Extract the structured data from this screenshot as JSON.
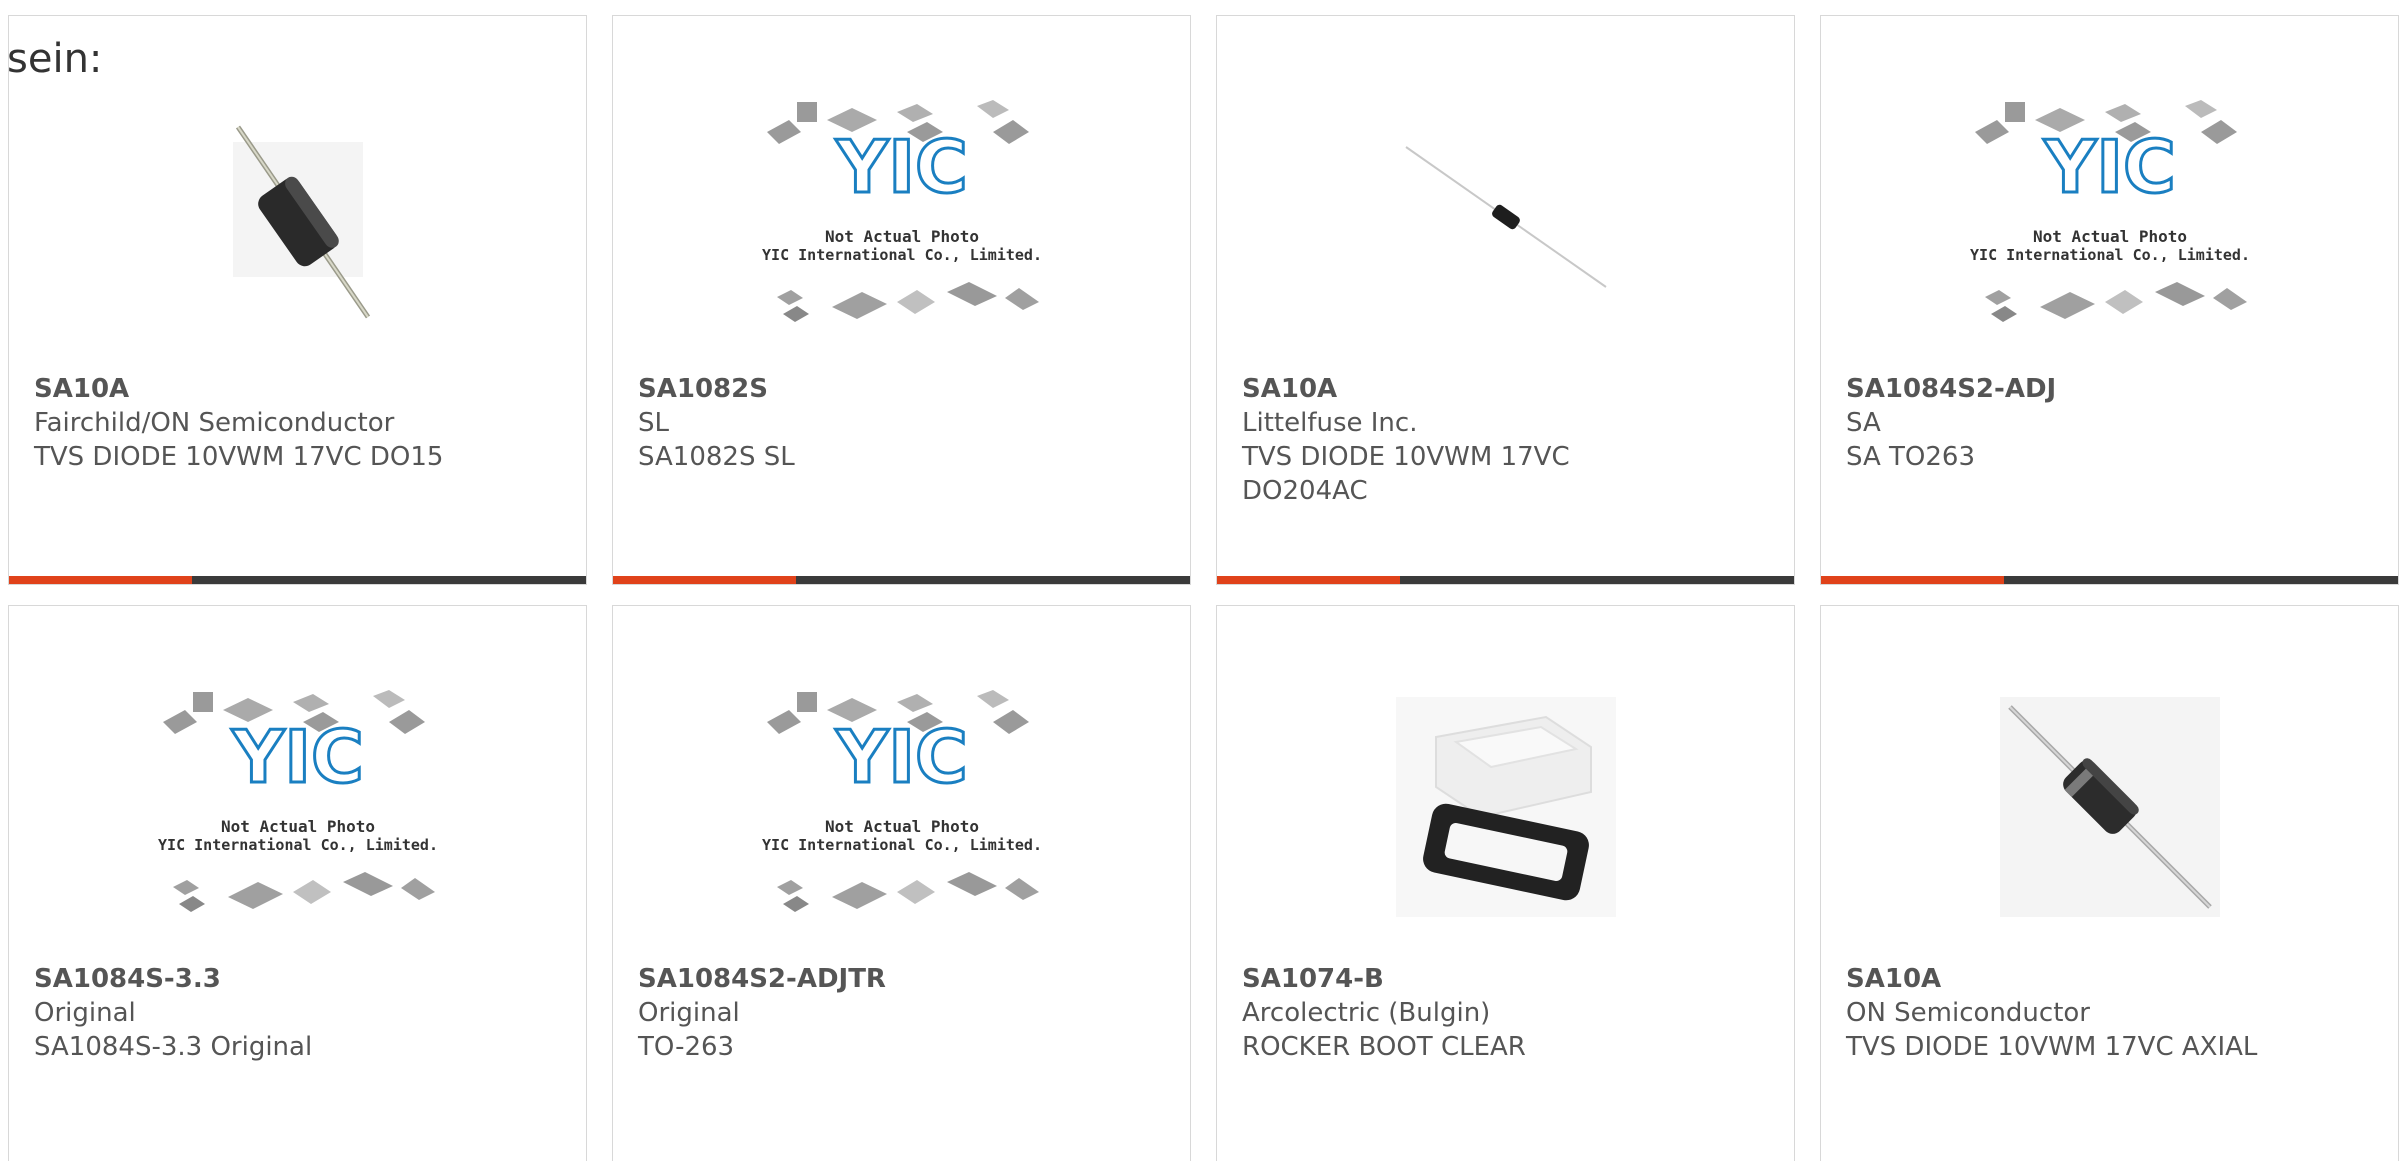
{
  "lead_text": "sein:",
  "placeholder_caption": {
    "line1": "Not Actual Photo",
    "line2": "YIC International Co., Limited.",
    "logo": "YIC"
  },
  "cards": [
    {
      "part": "SA10A",
      "manufacturer": "Fairchild/ON Semiconductor",
      "description": "TVS DIODE 10VWM 17VC DO15",
      "image": "axial-diode-large-photo"
    },
    {
      "part": "SA1082S",
      "manufacturer": "SL",
      "description": "SA1082S SL",
      "image": "yic-placeholder"
    },
    {
      "part": "SA10A",
      "manufacturer": "Littelfuse Inc.",
      "description": "TVS DIODE 10VWM 17VC DO204AC",
      "image": "axial-diode-small-photo"
    },
    {
      "part": "SA1084S2-ADJ",
      "manufacturer": "SA",
      "description": "SA TO263",
      "image": "yic-placeholder"
    },
    {
      "part": "SA1084S-3.3",
      "manufacturer": "Original",
      "description": "SA1084S-3.3 Original",
      "image": "yic-placeholder"
    },
    {
      "part": "SA1084S2-ADJTR",
      "manufacturer": "Original",
      "description": "TO-263",
      "image": "yic-placeholder"
    },
    {
      "part": "SA1074-B",
      "manufacturer": "Arcolectric (Bulgin)",
      "description": "ROCKER BOOT CLEAR",
      "image": "rocker-boot-photo"
    },
    {
      "part": "SA10A",
      "manufacturer": "ON Semiconductor",
      "description": "TVS DIODE 10VWM 17VC AXIAL",
      "image": "axial-diode-banded-photo"
    }
  ],
  "colors": {
    "accent": "#e0421a",
    "bar_dark": "#3a3a3a",
    "text": "#555555",
    "border": "#d8d8d8",
    "logo_blue": "#1a7fc1"
  }
}
